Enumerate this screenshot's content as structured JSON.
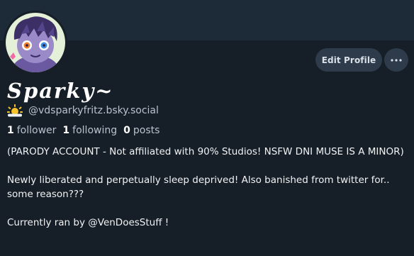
{
  "profile": {
    "display_name": "Sparky~",
    "handle": "@vdsparkyfritz.bsky.social",
    "handle_emoji": "sun-behind-cloud-icon",
    "followers_count": "1",
    "followers_label": "follower",
    "following_count": "1",
    "following_label": "following",
    "posts_count": "0",
    "posts_label": "posts",
    "bio": {
      "line1": "(PARODY ACCOUNT - Not affiliated with 90% Studios! NSFW DNI MUSE IS A MINOR)",
      "line2": "Newly liberated and perpetually sleep deprived! Also banished from twitter for.. some reason???",
      "line3": "Currently ran by @VenDoesStuff !"
    }
  },
  "actions": {
    "edit_profile_label": "Edit Profile",
    "more_icon": "ellipsis-icon"
  },
  "colors": {
    "background": "#161e27",
    "banner": "#1d2a38",
    "button_bg": "#2e3b4a",
    "secondary_text": "#b8c3cf"
  }
}
